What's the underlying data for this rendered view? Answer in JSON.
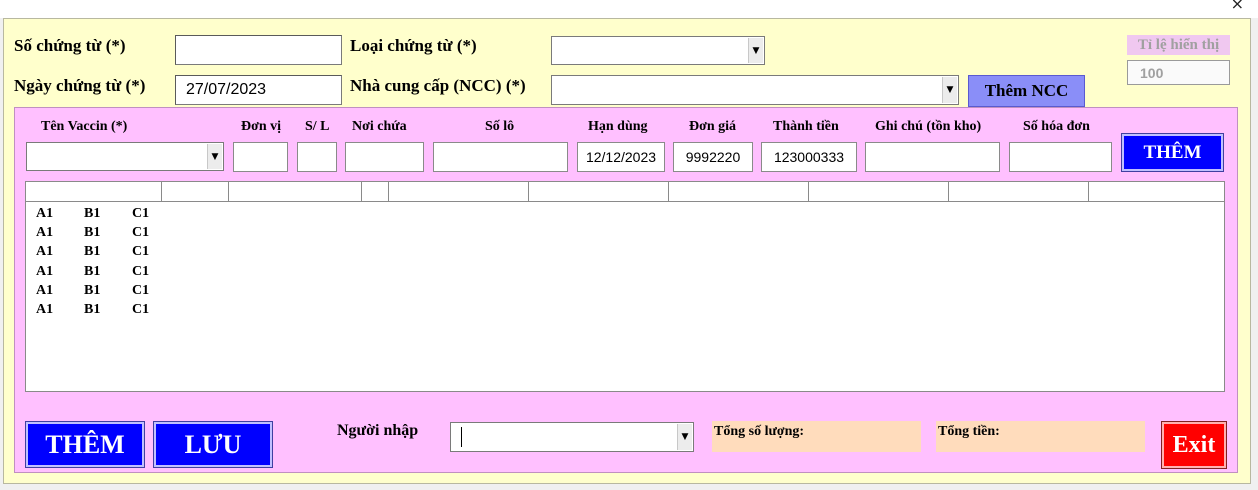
{
  "header": {
    "so_chung_tu_label": "Số chứng từ (*)",
    "so_chung_tu_value": "",
    "ngay_chung_tu_label": "Ngày chứng từ (*)",
    "ngay_chung_tu_value": "27/07/2023",
    "loai_chung_tu_label": "Loại chứng từ (*)",
    "loai_chung_tu_value": "",
    "nha_cung_cap_label": "Nhà cung cấp (NCC) (*)",
    "nha_cung_cap_value": "",
    "them_ncc_label": "Thêm NCC",
    "ti_le_label": "Tỉ lệ hiển thị",
    "ti_le_value": "100"
  },
  "detail": {
    "columns": {
      "ten_vaccin": "Tên Vaccin (*)",
      "don_vi": "Đơn vị",
      "sl": "S/ L",
      "noi_chua": "Nơi chứa",
      "so_lo": "Số lô",
      "han_dung": "Hạn dùng",
      "don_gia": "Đơn giá",
      "thanh_tien": "Thành tiền",
      "ghi_chu": "Ghi chú (tồn kho)",
      "so_hoa_don": "Số hóa đơn"
    },
    "values": {
      "ten_vaccin": "",
      "don_vi": "",
      "sl": "",
      "noi_chua": "",
      "so_lo": "",
      "han_dung": "12/12/2023",
      "don_gia": "9992220",
      "thanh_tien": "123000333",
      "ghi_chu": "",
      "so_hoa_don": ""
    },
    "them_label": "THÊM"
  },
  "list": {
    "rows": [
      [
        "A1",
        "B1",
        "C1"
      ],
      [
        "A1",
        "B1",
        "C1"
      ],
      [
        "A1",
        "B1",
        "C1"
      ],
      [
        "A1",
        "B1",
        "C1"
      ],
      [
        "A1",
        "B1",
        "C1"
      ],
      [
        "A1",
        "B1",
        "C1"
      ]
    ]
  },
  "footer": {
    "them_label": "THÊM",
    "luu_label": "LƯU",
    "nguoi_nhap_label": "Người nhập",
    "nguoi_nhap_value": "",
    "tong_so_luong_label": "Tổng số lượng:",
    "tong_tien_label": "Tổng tiền:",
    "exit_label": "Exit"
  },
  "colors": {
    "form_bg": "#ffffcc",
    "panel_bg": "#ffc0ff",
    "primary_button": "#0000ff",
    "ncc_button": "#8a8ef8",
    "exit_button": "#ff0000",
    "summary_bg": "#ffdcbc"
  },
  "icons": {
    "close": "close-icon",
    "dropdown": "chevron-down-icon"
  }
}
